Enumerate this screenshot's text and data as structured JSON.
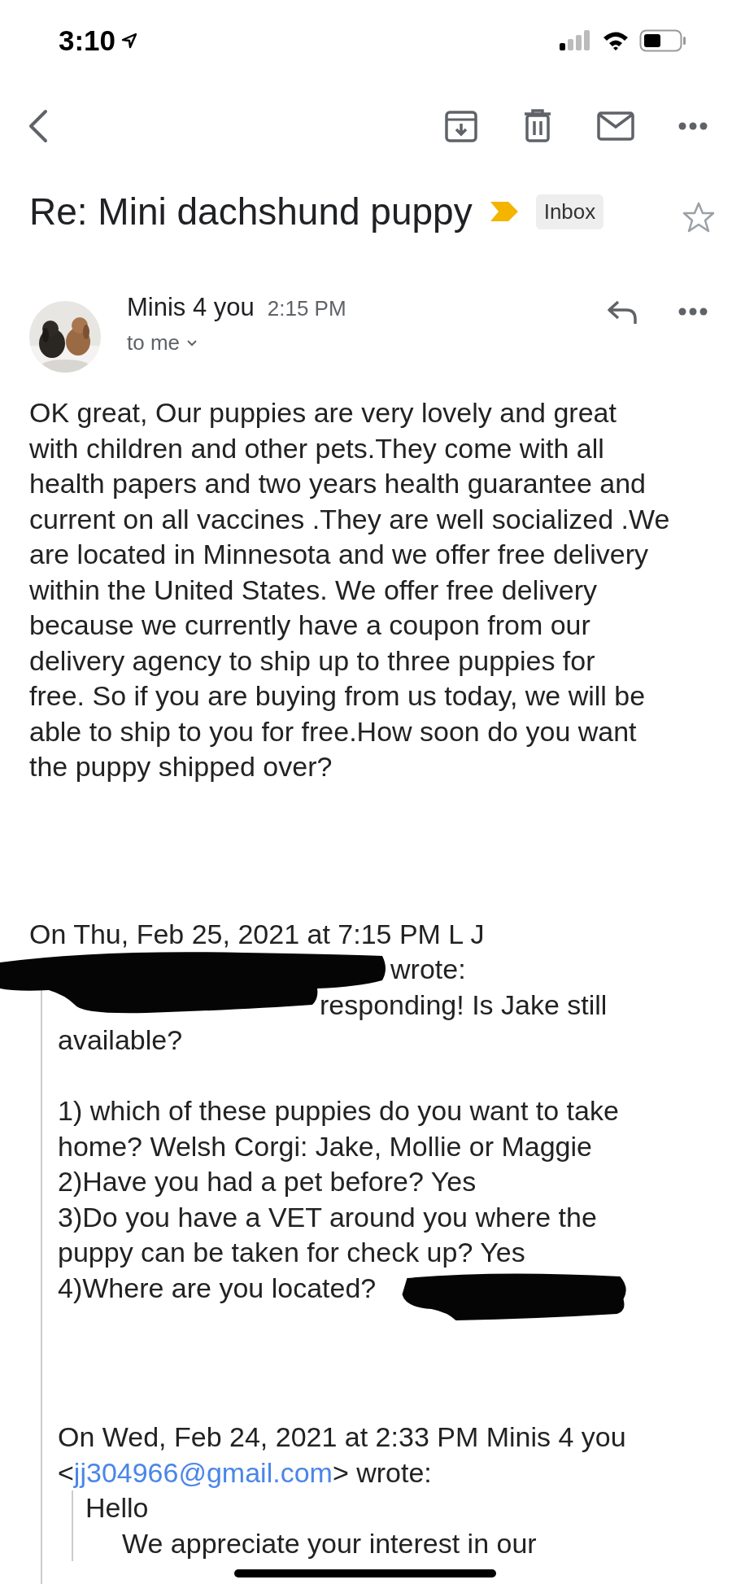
{
  "status_bar": {
    "time": "3:10"
  },
  "subject": "Re: Mini dachshund puppy",
  "important": true,
  "label": "Inbox",
  "starred": false,
  "sender": {
    "name": "Minis 4 you",
    "time": "2:15 PM",
    "recipient": "to me"
  },
  "body": "OK great, Our puppies are very lovely and great\nwith children and other pets.They come with all\nhealth papers and two years health guarantee and\ncurrent on all vaccines .They are well socialized .We\nare located in Minnesota and we offer free delivery\nwithin the United States. We offer free delivery\nbecause we currently have a coupon from our\ndelivery agency to ship up to three puppies for\nfree. So if you are buying from us today, we will be\nable to ship to you for free.How soon do you want\nthe puppy shipped over?",
  "quote": {
    "header": "On Thu, Feb 25, 2021 at 7:15 PM L J",
    "header_end": "wrote:",
    "first_line": "responding! Is Jake still\navailable?",
    "answers": [
      "1) which of these puppies do you want to take\nhome? Welsh Corgi: Jake, Mollie or Maggie",
      "2)Have you had a pet before? Yes",
      "3)Do you have a VET around you where the\npuppy can be taken for check up? Yes",
      "4)Where are you located?"
    ],
    "nested": {
      "header": "On Wed, Feb 24, 2021 at 2:33 PM Minis 4 you",
      "before": "<",
      "email": "jj304966@gmail.com",
      "after": "> wrote:",
      "greeting": "Hello",
      "line": "We appreciate your interest in our"
    }
  }
}
